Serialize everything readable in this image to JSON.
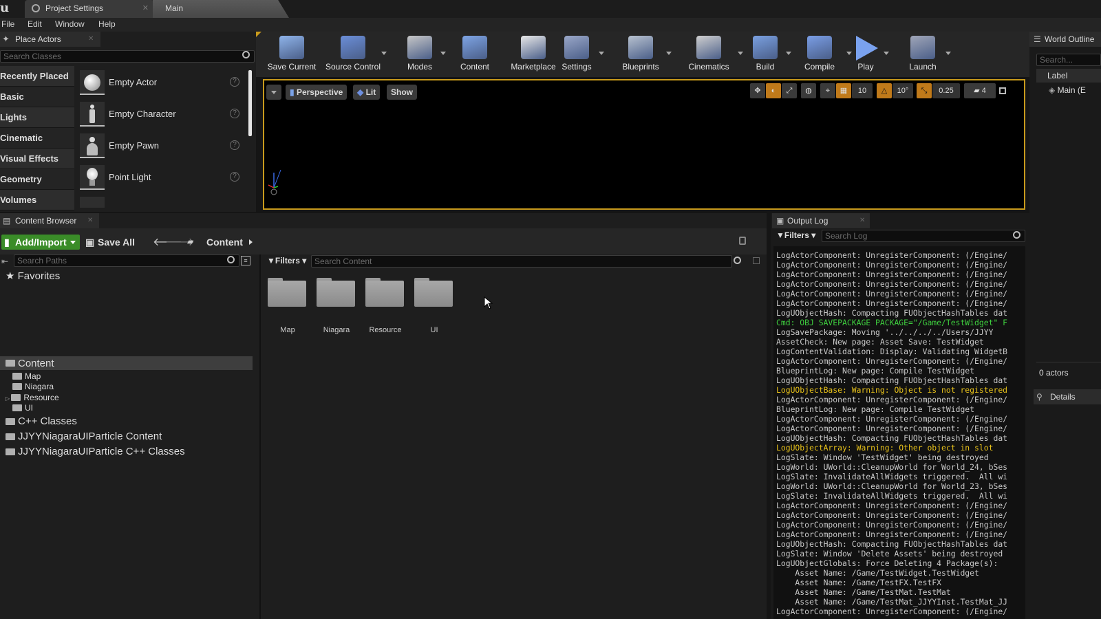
{
  "titlebar": {
    "tabs": [
      {
        "label": "Project Settings"
      },
      {
        "label": "Main"
      }
    ]
  },
  "menu": [
    "File",
    "Edit",
    "Window",
    "Help"
  ],
  "place_actors": {
    "tab_label": "Place Actors",
    "search_placeholder": "Search Classes",
    "categories": [
      "Recently Placed",
      "Basic",
      "Lights",
      "Cinematic",
      "Visual Effects",
      "Geometry",
      "Volumes"
    ],
    "actors": [
      {
        "label": "Empty Actor",
        "icon": "sphere-icon"
      },
      {
        "label": "Empty Character",
        "icon": "character-icon"
      },
      {
        "label": "Empty Pawn",
        "icon": "pawn-icon"
      },
      {
        "label": "Point Light",
        "icon": "point-light-icon"
      }
    ]
  },
  "toolbar": {
    "buttons": [
      {
        "label": "Save Current",
        "icon": "save-icon"
      },
      {
        "label": "Source Control",
        "icon": "source-control-icon"
      },
      {
        "label": "Modes",
        "icon": "modes-icon"
      },
      {
        "label": "Content",
        "icon": "content-icon"
      },
      {
        "label": "Marketplace",
        "icon": "marketplace-icon"
      },
      {
        "label": "Settings",
        "icon": "settings-icon"
      },
      {
        "label": "Blueprints",
        "icon": "blueprints-icon"
      },
      {
        "label": "Cinematics",
        "icon": "cinematics-icon"
      },
      {
        "label": "Build",
        "icon": "build-icon"
      },
      {
        "label": "Compile",
        "icon": "compile-icon"
      },
      {
        "label": "Play",
        "icon": "play-icon"
      },
      {
        "label": "Launch",
        "icon": "launch-icon"
      }
    ]
  },
  "viewport": {
    "perspective": "Perspective",
    "lit": "Lit",
    "show": "Show",
    "grid_snap": "10",
    "rotation_snap": "10°",
    "scale_snap": "0.25",
    "camera_speed": "4"
  },
  "world_outliner": {
    "tab_label": "World Outline",
    "search_placeholder": "Search...",
    "column_label": "Label",
    "item": "Main (E",
    "actor_count": "0 actors",
    "details_label": "Details"
  },
  "content_browser": {
    "tab_label": "Content Browser",
    "add_import": "Add/Import",
    "save_all": "Save All",
    "path": "Content",
    "search_paths_placeholder": "Search Paths",
    "filters": "Filters",
    "search_content_placeholder": "Search Content",
    "favorites": "Favorites",
    "folders": [
      "Map",
      "Niagara",
      "Resource",
      "UI"
    ],
    "tree": {
      "root": "Content",
      "children": [
        "Map",
        "Niagara",
        "Resource",
        "UI"
      ],
      "others": [
        "C++ Classes",
        "JJYYNiagaraUIParticle Content",
        "JJYYNiagaraUIParticle C++ Classes"
      ]
    }
  },
  "output_log": {
    "tab_label": "Output Log",
    "filters": "Filters",
    "search_placeholder": "Search Log",
    "colors": {
      "normal": "#c9c9c9",
      "cmd": "#3ecf3e",
      "warning": "#e8c21a"
    },
    "lines": [
      {
        "text": "LogActorComponent: UnregisterComponent: (/Engine/",
        "kind": "normal"
      },
      {
        "text": "LogActorComponent: UnregisterComponent: (/Engine/",
        "kind": "normal"
      },
      {
        "text": "LogActorComponent: UnregisterComponent: (/Engine/",
        "kind": "normal"
      },
      {
        "text": "LogActorComponent: UnregisterComponent: (/Engine/",
        "kind": "normal"
      },
      {
        "text": "LogActorComponent: UnregisterComponent: (/Engine/",
        "kind": "normal"
      },
      {
        "text": "LogActorComponent: UnregisterComponent: (/Engine/",
        "kind": "normal"
      },
      {
        "text": "LogUObjectHash: Compacting FUObjectHashTables dat",
        "kind": "normal"
      },
      {
        "text": "Cmd: OBJ SAVEPACKAGE PACKAGE=\"/Game/TestWidget\" F",
        "kind": "cmd"
      },
      {
        "text": "LogSavePackage: Moving '../../../../Users/JJYY",
        "kind": "normal"
      },
      {
        "text": "AssetCheck: New page: Asset Save: TestWidget",
        "kind": "normal"
      },
      {
        "text": "LogContentValidation: Display: Validating WidgetB",
        "kind": "normal"
      },
      {
        "text": "LogActorComponent: UnregisterComponent: (/Engine/",
        "kind": "normal"
      },
      {
        "text": "BlueprintLog: New page: Compile TestWidget",
        "kind": "normal"
      },
      {
        "text": "LogUObjectHash: Compacting FUObjectHashTables dat",
        "kind": "normal"
      },
      {
        "text": "LogUObjectBase: Warning: Object is not registered",
        "kind": "warning"
      },
      {
        "text": "LogActorComponent: UnregisterComponent: (/Engine/",
        "kind": "normal"
      },
      {
        "text": "BlueprintLog: New page: Compile TestWidget",
        "kind": "normal"
      },
      {
        "text": "LogActorComponent: UnregisterComponent: (/Engine/",
        "kind": "normal"
      },
      {
        "text": "LogActorComponent: UnregisterComponent: (/Engine/",
        "kind": "normal"
      },
      {
        "text": "LogUObjectHash: Compacting FUObjectHashTables dat",
        "kind": "normal"
      },
      {
        "text": "LogUObjectArray: Warning: Other object in slot",
        "kind": "warning"
      },
      {
        "text": "LogSlate: Window 'TestWidget' being destroyed",
        "kind": "normal"
      },
      {
        "text": "LogWorld: UWorld::CleanupWorld for World_24, bSes",
        "kind": "normal"
      },
      {
        "text": "LogSlate: InvalidateAllWidgets triggered.  All wi",
        "kind": "normal"
      },
      {
        "text": "LogWorld: UWorld::CleanupWorld for World_23, bSes",
        "kind": "normal"
      },
      {
        "text": "LogSlate: InvalidateAllWidgets triggered.  All wi",
        "kind": "normal"
      },
      {
        "text": "LogActorComponent: UnregisterComponent: (/Engine/",
        "kind": "normal"
      },
      {
        "text": "LogActorComponent: UnregisterComponent: (/Engine/",
        "kind": "normal"
      },
      {
        "text": "LogActorComponent: UnregisterComponent: (/Engine/",
        "kind": "normal"
      },
      {
        "text": "LogActorComponent: UnregisterComponent: (/Engine/",
        "kind": "normal"
      },
      {
        "text": "LogUObjectHash: Compacting FUObjectHashTables dat",
        "kind": "normal"
      },
      {
        "text": "LogSlate: Window 'Delete Assets' being destroyed",
        "kind": "normal"
      },
      {
        "text": "LogUObjectGlobals: Force Deleting 4 Package(s):",
        "kind": "normal"
      },
      {
        "text": "    Asset Name: /Game/TestWidget.TestWidget",
        "kind": "normal"
      },
      {
        "text": "    Asset Name: /Game/TestFX.TestFX",
        "kind": "normal"
      },
      {
        "text": "    Asset Name: /Game/TestMat.TestMat",
        "kind": "normal"
      },
      {
        "text": "    Asset Name: /Game/TestMat_JJYYInst.TestMat_JJ",
        "kind": "normal"
      },
      {
        "text": "LogActorComponent: UnregisterComponent: (/Engine/",
        "kind": "normal"
      }
    ]
  }
}
